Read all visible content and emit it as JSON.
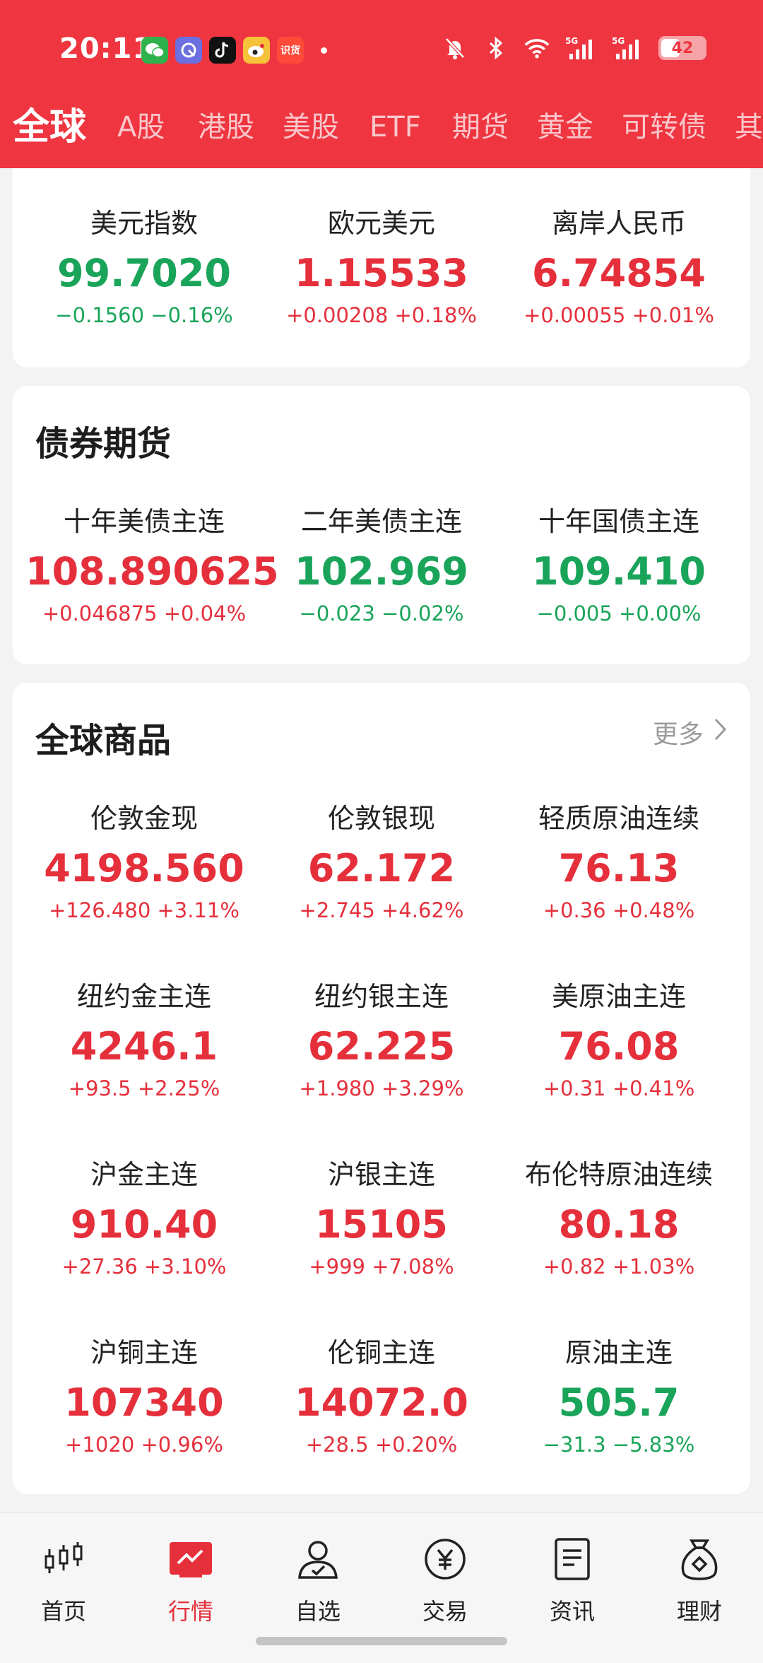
{
  "status_bar": {
    "time": "20:11",
    "battery": "42",
    "app_icons": [
      "wechat-icon",
      "browser-icon",
      "tiktok-icon",
      "weibo-icon",
      "shihuo-icon"
    ],
    "shihuo_label": "识货",
    "signal_labels": [
      "5G",
      "5G"
    ]
  },
  "tabs": [
    "全球",
    "A股",
    "港股",
    "美股",
    "ETF",
    "期货",
    "黄金",
    "可转债",
    "其"
  ],
  "colors": {
    "header_red": "#ee3540",
    "up": "#e5303c",
    "down": "#19a45a"
  },
  "fx": [
    {
      "name": "美元指数",
      "price": "99.7020",
      "change": "−0.1560  −0.16%",
      "dir": "down"
    },
    {
      "name": "欧元美元",
      "price": "1.15533",
      "change": "+0.00208  +0.18%",
      "dir": "up"
    },
    {
      "name": "离岸人民币",
      "price": "6.74854",
      "change": "+0.00055  +0.01%",
      "dir": "up"
    }
  ],
  "bonds": {
    "title": "债券期货",
    "items": [
      {
        "name": "十年美债主连",
        "price": "108.890625",
        "change": "+0.046875  +0.04%",
        "dir": "up"
      },
      {
        "name": "二年美债主连",
        "price": "102.969",
        "change": "−0.023  −0.02%",
        "dir": "down"
      },
      {
        "name": "十年国债主连",
        "price": "109.410",
        "change": "−0.005  +0.00%",
        "dir": "down"
      }
    ]
  },
  "commodities": {
    "title": "全球商品",
    "more_label": "更多",
    "items": [
      {
        "name": "伦敦金现",
        "price": "4198.560",
        "change": "+126.480  +3.11%",
        "dir": "up"
      },
      {
        "name": "伦敦银现",
        "price": "62.172",
        "change": "+2.745  +4.62%",
        "dir": "up"
      },
      {
        "name": "轻质原油连续",
        "price": "76.13",
        "change": "+0.36  +0.48%",
        "dir": "up"
      },
      {
        "name": "纽约金主连",
        "price": "4246.1",
        "change": "+93.5  +2.25%",
        "dir": "up"
      },
      {
        "name": "纽约银主连",
        "price": "62.225",
        "change": "+1.980  +3.29%",
        "dir": "up"
      },
      {
        "name": "美原油主连",
        "price": "76.08",
        "change": "+0.31  +0.41%",
        "dir": "up"
      },
      {
        "name": "沪金主连",
        "price": "910.40",
        "change": "+27.36  +3.10%",
        "dir": "up"
      },
      {
        "name": "沪银主连",
        "price": "15105",
        "change": "+999  +7.08%",
        "dir": "up"
      },
      {
        "name": "布伦特原油连续",
        "price": "80.18",
        "change": "+0.82  +1.03%",
        "dir": "up"
      },
      {
        "name": "沪铜主连",
        "price": "107340",
        "change": "+1020  +0.96%",
        "dir": "up"
      },
      {
        "name": "伦铜主连",
        "price": "14072.0",
        "change": "+28.5  +0.20%",
        "dir": "up"
      },
      {
        "name": "原油主连",
        "price": "505.7",
        "change": "−31.3  −5.83%",
        "dir": "down"
      }
    ]
  },
  "bottom_nav": [
    {
      "label": "首页",
      "icon": "candlestick-icon",
      "active": false
    },
    {
      "label": "行情",
      "icon": "market-chart-icon",
      "active": true
    },
    {
      "label": "自选",
      "icon": "user-star-icon",
      "active": false
    },
    {
      "label": "交易",
      "icon": "yuan-coin-icon",
      "active": false
    },
    {
      "label": "资讯",
      "icon": "news-document-icon",
      "active": false
    },
    {
      "label": "理财",
      "icon": "money-bag-icon",
      "active": false
    }
  ]
}
